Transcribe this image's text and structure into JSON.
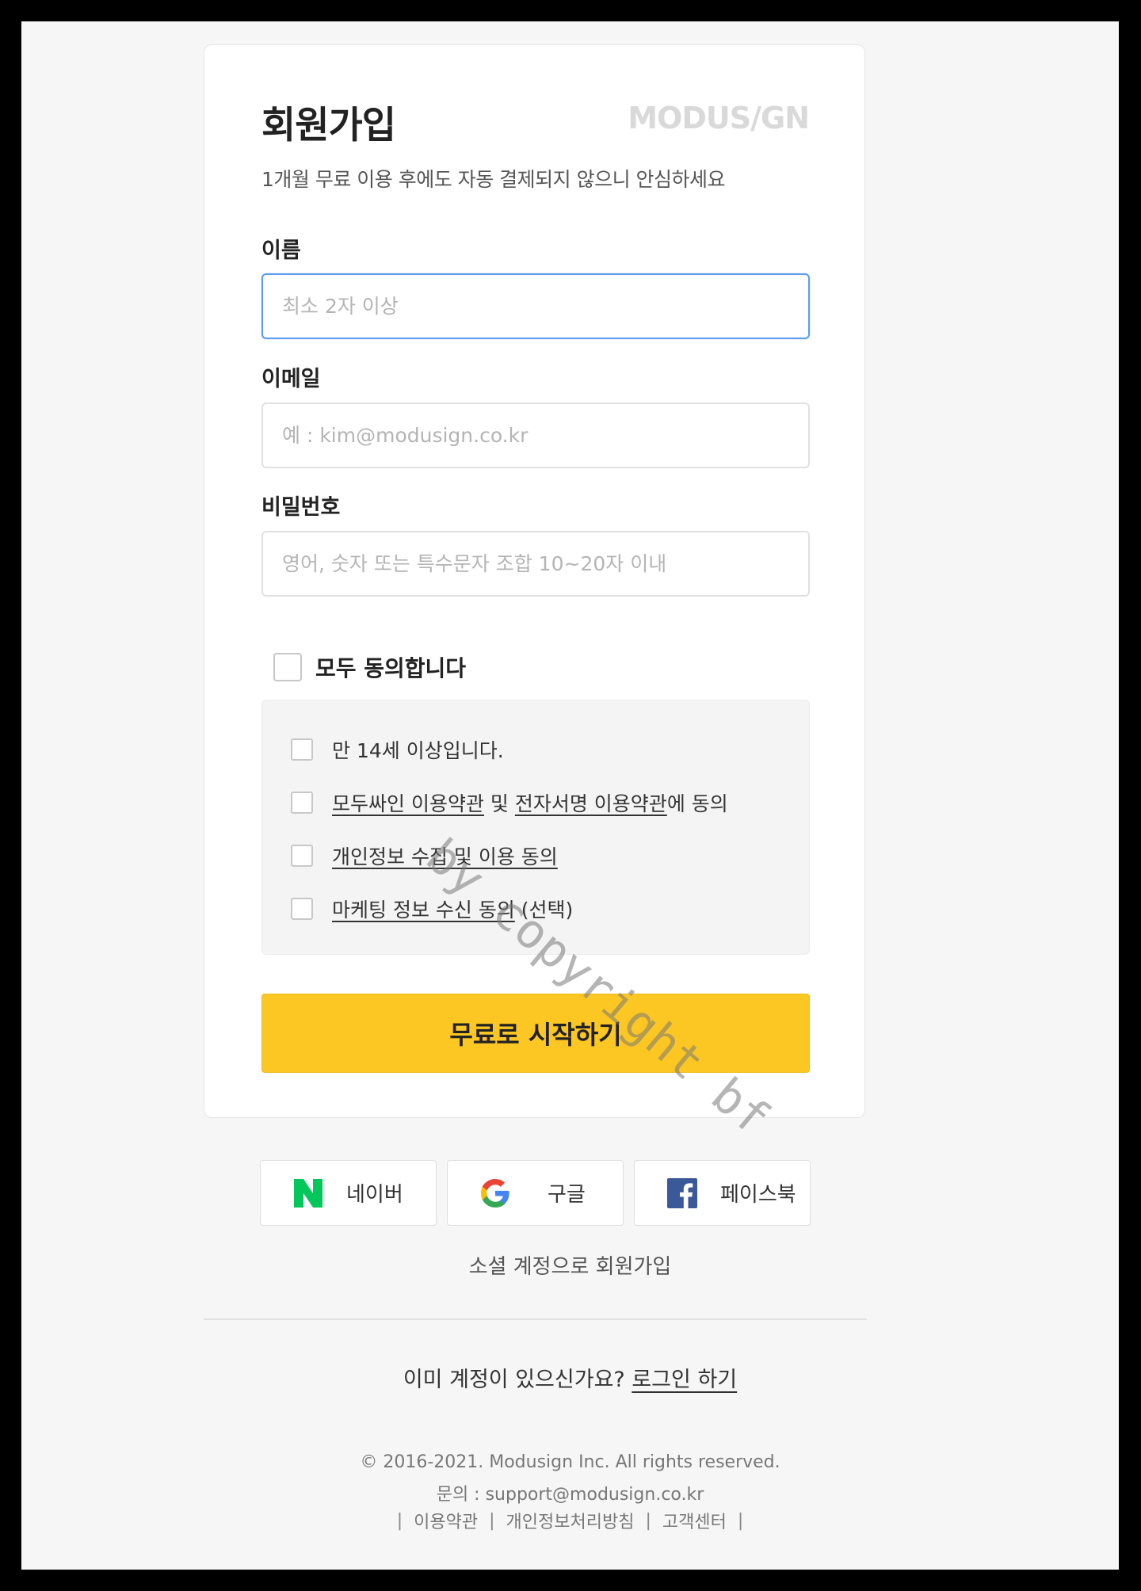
{
  "signup": {
    "title": "회원가입",
    "logo": "MODUS/GN",
    "subtitle": "1개월 무료 이용 후에도 자동 결제되지 않으니 안심하세요",
    "name": {
      "label": "이름",
      "placeholder": "최소 2자 이상",
      "value": ""
    },
    "email": {
      "label": "이메일",
      "placeholder": "예 : kim@modusign.co.kr",
      "value": ""
    },
    "password": {
      "label": "비밀번호",
      "placeholder": "영어, 숫자 또는 특수문자 조합 10~20자 이내",
      "value": ""
    },
    "agree_all": {
      "label": "모두 동의합니다",
      "checked": false
    },
    "terms": {
      "age": "만 14세 이상입니다.",
      "service_link1": "모두싸인 이용약관",
      "service_mid": " 및 ",
      "service_link2": "전자서명 이용약관",
      "service_suffix": "에 동의",
      "privacy_link": "개인정보 수집 및 이용 동의",
      "marketing_link": "마케팅 정보 수신 동의",
      "marketing_suffix": " (선택)"
    },
    "submit_label": "무료로 시작하기"
  },
  "social": {
    "buttons": [
      {
        "label": "네이버",
        "icon": "naver-icon",
        "color": "#03c75a"
      },
      {
        "label": "구글",
        "icon": "google-icon"
      },
      {
        "label": "페이스북",
        "icon": "facebook-icon",
        "color": "#3b5998"
      }
    ],
    "caption": "소셜 계정으로 회원가입"
  },
  "login": {
    "prompt": "이미 계정이 있으신가요?",
    "link": "로그인 하기"
  },
  "footer": {
    "copyright": "© 2016-2021. Modusign Inc. All rights reserved.",
    "contact": "문의 : support@modusign.co.kr",
    "links": [
      "이용약관",
      "개인정보처리방침",
      "고객센터"
    ]
  },
  "watermark": "by copyright bf",
  "colors": {
    "accent": "#fdc723",
    "focus": "#5b9cf0"
  }
}
